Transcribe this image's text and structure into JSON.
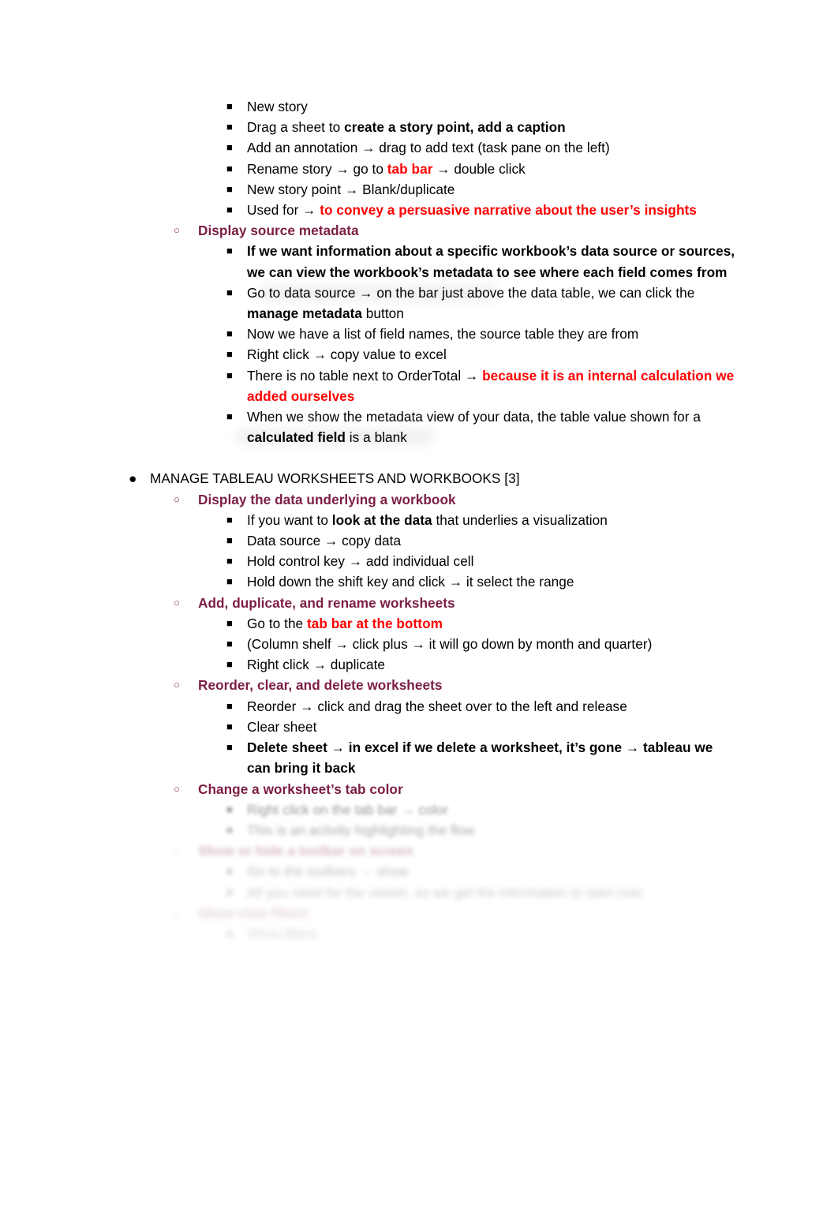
{
  "document": {
    "background_color": "#ffffff",
    "text_color": "#000000",
    "accent_purple": "#7B1E45",
    "accent_red": "#FF0000"
  },
  "bullets": {
    "disc": "●",
    "circle": "○",
    "square": "■"
  },
  "sections": {
    "story_items": [
      {
        "text": "New story"
      },
      {
        "pre": "Drag a sheet to ",
        "bold": "create a story point, add a caption",
        "post": ""
      },
      {
        "text": "Add an annotation → drag to add text (task pane on the left)"
      },
      {
        "pre": "Rename story → go to ",
        "red": "tab bar",
        "post": " → double click"
      },
      {
        "text": "New story point → Blank/duplicate"
      },
      {
        "pre": "Used for → ",
        "red": "to convey a persuasive narrative about the user’s insights",
        "post": ""
      }
    ],
    "display_source_metadata": {
      "heading": "Display source metadata",
      "items": [
        {
          "bold_all": "If we want information about a specific workbook’s data source or sources, we can view the workbook’s metadata to see where each field comes from"
        },
        {
          "pre": "Go to data source → on the bar just above the data table, we can click the ",
          "bold": "manage metadata",
          "post": " button"
        },
        {
          "text": "Now we have a list of field names, the source table they are from"
        },
        {
          "text": "Right click → copy value to excel"
        },
        {
          "pre": "There is no table next to OrderTotal → ",
          "red": "because it is an internal calculation we added ourselves",
          "post": ""
        },
        {
          "pre": "When we show the metadata view of your data, the table value shown for a ",
          "bold": "calculated field",
          "post": " is a blank"
        }
      ]
    },
    "manage_tableau": {
      "heading": "MANAGE TABLEAU WORKSHEETS AND WORKBOOKS [3]",
      "subsections": [
        {
          "heading": "Display the data underlying a workbook",
          "items": [
            {
              "pre": "If you want to ",
              "bold": "look at the data",
              "post": " that underlies a visualization"
            },
            {
              "text": "Data source → copy data"
            },
            {
              "text": "Hold control key → add individual cell"
            },
            {
              "text": "Hold down the shift key and click → it select the range"
            }
          ]
        },
        {
          "heading": "Add, duplicate, and rename worksheets",
          "items": [
            {
              "pre": "Go to the ",
              "red": "tab bar at the bottom",
              "post": ""
            },
            {
              "text": "(Column shelf → click plus → it will go down by month and quarter)"
            },
            {
              "text": "Right click → duplicate"
            }
          ]
        },
        {
          "heading": "Reorder, clear, and delete worksheets",
          "items": [
            {
              "text": "Reorder → click and drag the sheet over to the left and release"
            },
            {
              "text": "Clear sheet"
            },
            {
              "bold_all": "Delete sheet → in excel if we delete a worksheet, it’s gone → tableau we can bring it back"
            }
          ]
        },
        {
          "heading": "Change a worksheet’s tab color",
          "obscured": true,
          "items": [
            {
              "text": "Right click on the tab bar → color"
            },
            {
              "text": "This is an activity highlighting the flow"
            }
          ]
        },
        {
          "heading": "Show or hide a toolbar on screen",
          "obscured": true,
          "items": [
            {
              "text": "Go to the toolbars → show"
            },
            {
              "text": "All you need for the viewer, so we get the information to start over"
            }
          ]
        },
        {
          "heading": "Show view filters",
          "obscured": true,
          "items": [
            {
              "text": "Show filters"
            }
          ]
        }
      ]
    }
  }
}
